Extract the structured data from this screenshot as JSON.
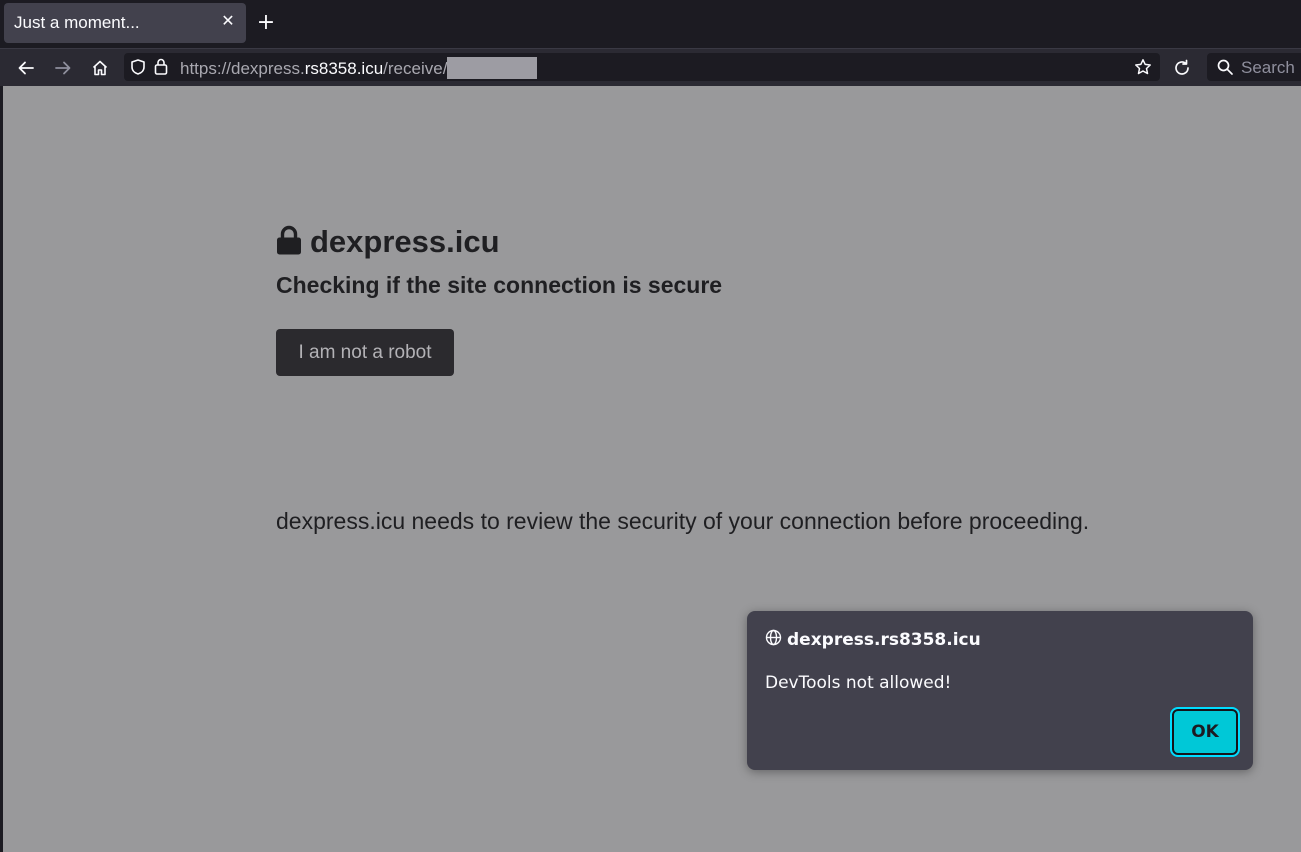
{
  "browser": {
    "tab": {
      "title": "Just a moment...",
      "close_glyph": "✕"
    },
    "new_tab_glyph": "+",
    "urlbar": {
      "prefix": "https://dexpress.",
      "domain": "rs8358.icu",
      "path": "/receive/"
    },
    "search": {
      "placeholder": "Search"
    }
  },
  "page": {
    "site_title": "dexpress.icu",
    "subtitle": "Checking if the site connection is secure",
    "robot_button": "I am not a robot",
    "body_text": "dexpress.icu needs to review the security of your connection before proceeding."
  },
  "dialog": {
    "origin": "dexpress.rs8358.icu",
    "message": "DevTools not allowed!",
    "ok_label": "OK"
  },
  "colors": {
    "page_background": "#99999b",
    "dialog_background": "#42414d",
    "ok_accent": "#00c8d7"
  }
}
